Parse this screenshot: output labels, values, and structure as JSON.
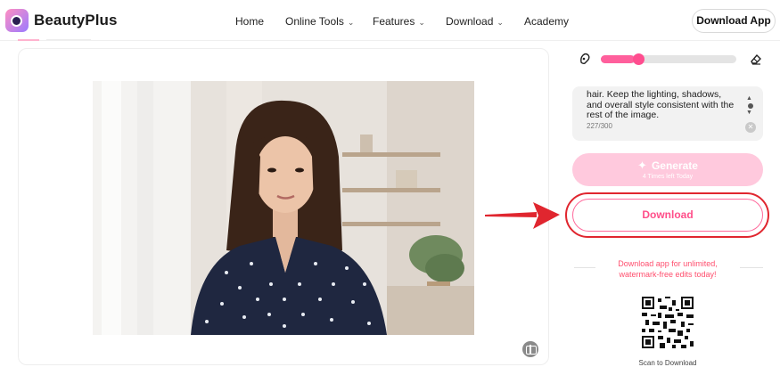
{
  "header": {
    "brand": "BeautyPlus",
    "nav": [
      {
        "label": "Home",
        "dropdown": false
      },
      {
        "label": "Online Tools",
        "dropdown": true
      },
      {
        "label": "Features",
        "dropdown": true
      },
      {
        "label": "Download",
        "dropdown": true
      },
      {
        "label": "Academy",
        "dropdown": false
      }
    ],
    "download_app_label": "Download App"
  },
  "editor": {
    "brush_slider_value": 0.25,
    "prompt": {
      "text": "hair. Keep the lighting, shadows, and overall style consistent with the rest of the image.",
      "count": "227/300"
    },
    "generate": {
      "label": "Generate",
      "sub": "4 Times left Today"
    },
    "download_label": "Download",
    "promo_text": "Download app for unlimited, watermark-free edits today!",
    "scan_label": "Scan to Download"
  },
  "colors": {
    "accent_pink": "#ff4f8a",
    "generate_bg": "#ffc9dd",
    "highlight_red": "#e0262f"
  },
  "icons": {
    "brush": "brush-icon",
    "eraser": "eraser-icon",
    "clear": "clear-icon",
    "compare": "compare-icon",
    "sparkle": "sparkle-icon",
    "chevron": "chevron-down-icon"
  }
}
